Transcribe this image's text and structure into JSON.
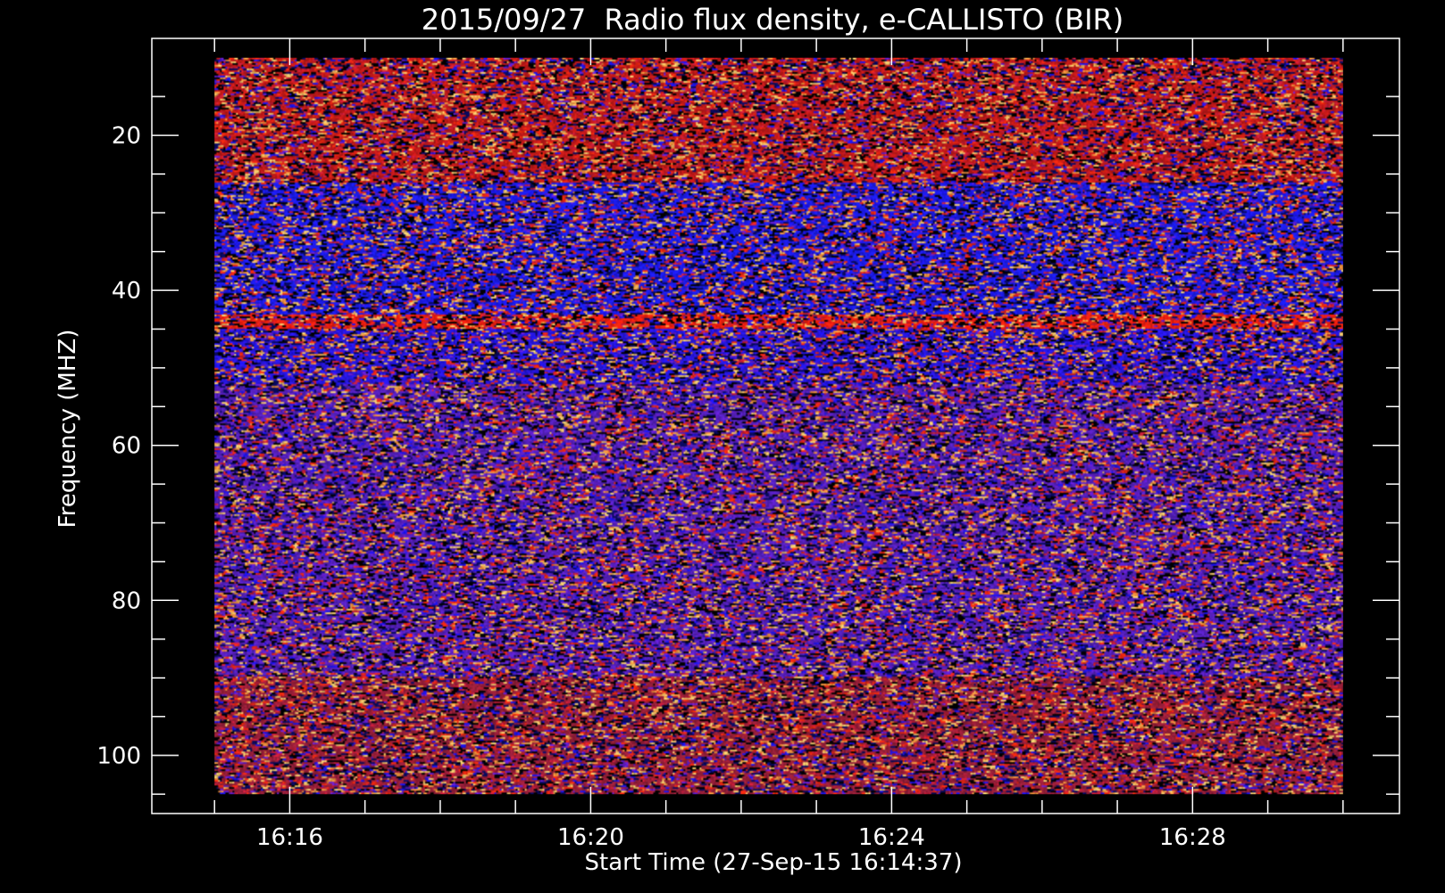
{
  "chart_data": {
    "type": "heatmap",
    "title": "2015/09/27  Radio flux density, e-CALLISTO (BIR)",
    "xlabel": "Start Time (27-Sep-15 16:14:37)",
    "ylabel": "Frequency (MHZ)",
    "x_unit": "UT time",
    "y_unit": "MHz",
    "xlim": [
      "16:14:10",
      "16:30:45"
    ],
    "ylim": [
      107.5,
      7.5
    ],
    "y_inverted": true,
    "data_xrange": [
      "16:15:00",
      "16:30:00"
    ],
    "data_yrange": [
      10,
      105
    ],
    "x_major_ticks": [
      "16:16",
      "16:20",
      "16:24",
      "16:28"
    ],
    "x_minor_step_minutes": 1,
    "y_major_ticks": [
      20,
      40,
      60,
      80,
      100
    ],
    "y_minor_step": 5,
    "grid": false,
    "colorbar": false,
    "colormap": [
      "#000000",
      "#0a0a64",
      "#1e14ff",
      "#6a1ed8",
      "#d21e3c",
      "#ff2a10",
      "#ff9a40",
      "#ffd070"
    ],
    "frequency_bands": [
      {
        "from_mhz": 10,
        "to_mhz": 26,
        "dominant_color": "#cc1a1a"
      },
      {
        "from_mhz": 26,
        "to_mhz": 44,
        "dominant_color": "#1e1eff"
      },
      {
        "from_mhz": 43,
        "to_mhz": 45,
        "dominant_color": "#ff2010"
      },
      {
        "from_mhz": 45,
        "to_mhz": 52,
        "dominant_color": "#2a18f0"
      },
      {
        "from_mhz": 52,
        "to_mhz": 90,
        "dominant_color": "#5a22c8"
      },
      {
        "from_mhz": 90,
        "to_mhz": 105,
        "dominant_color": "#a0203c"
      }
    ]
  }
}
